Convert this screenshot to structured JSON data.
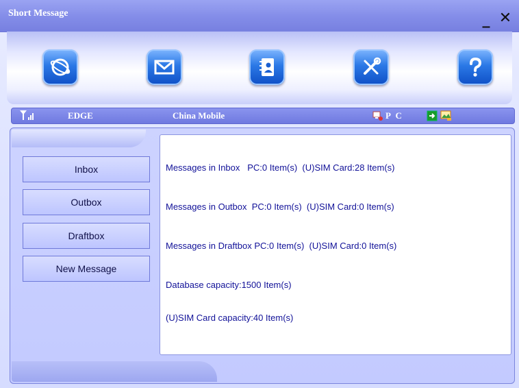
{
  "window": {
    "title": "Short Message"
  },
  "title_buttons": {
    "minimize": "_",
    "close": "✕"
  },
  "toolbar": {
    "buttons": [
      {
        "name": "connect",
        "icon": "globe-icon"
      },
      {
        "name": "short-message",
        "icon": "envelope-icon"
      },
      {
        "name": "phonebook",
        "icon": "contacts-icon"
      },
      {
        "name": "settings",
        "icon": "tools-icon"
      },
      {
        "name": "help",
        "icon": "help-icon"
      }
    ]
  },
  "status": {
    "network": "EDGE",
    "operator": "China Mobile",
    "mode": "P C"
  },
  "sidebar": {
    "items": [
      {
        "label": "Inbox"
      },
      {
        "label": "Outbox"
      },
      {
        "label": "Draftbox"
      },
      {
        "label": "New Message"
      }
    ]
  },
  "info": {
    "inbox": "Messages in Inbox   PC:0 Item(s)  (U)SIM Card:28 Item(s)",
    "outbox": "Messages in Outbox  PC:0 Item(s)  (U)SIM Card:0 Item(s)",
    "draftbox": "Messages in Draftbox PC:0 Item(s)  (U)SIM Card:0 Item(s)",
    "db_capacity": "Database capacity:1500 Item(s)",
    "sim_capacity": "(U)SIM Card capacity:40 Item(s)"
  },
  "colors": {
    "titlebar": "#838ce8",
    "icon_blue": "#2b79e6",
    "info_text": "#111198"
  }
}
